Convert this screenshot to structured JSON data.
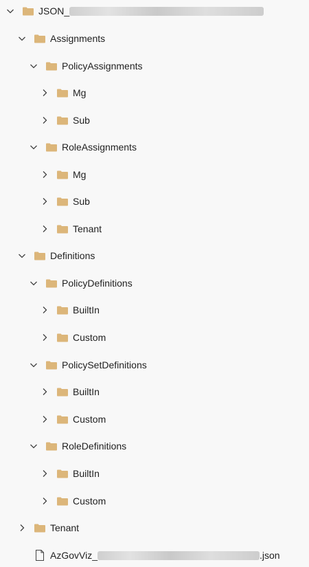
{
  "tree": {
    "root": {
      "label": "JSON_",
      "expanded": true,
      "icon": "folder-icon"
    },
    "assignments": {
      "label": "Assignments",
      "expanded": true,
      "icon": "folder-icon"
    },
    "policy_assignments": {
      "label": "PolicyAssignments",
      "expanded": true,
      "icon": "folder-icon"
    },
    "pa_mg": {
      "label": "Mg",
      "expanded": false,
      "icon": "folder-icon"
    },
    "pa_sub": {
      "label": "Sub",
      "expanded": false,
      "icon": "folder-icon"
    },
    "role_assignments": {
      "label": "RoleAssignments",
      "expanded": true,
      "icon": "folder-icon"
    },
    "ra_mg": {
      "label": "Mg",
      "expanded": false,
      "icon": "folder-icon"
    },
    "ra_sub": {
      "label": "Sub",
      "expanded": false,
      "icon": "folder-icon"
    },
    "ra_tenant": {
      "label": "Tenant",
      "expanded": false,
      "icon": "folder-icon"
    },
    "definitions": {
      "label": "Definitions",
      "expanded": true,
      "icon": "folder-icon"
    },
    "policy_definitions": {
      "label": "PolicyDefinitions",
      "expanded": true,
      "icon": "folder-icon"
    },
    "pd_builtin": {
      "label": "BuiltIn",
      "expanded": false,
      "icon": "folder-icon"
    },
    "pd_custom": {
      "label": "Custom",
      "expanded": false,
      "icon": "folder-icon"
    },
    "policyset_definitions": {
      "label": "PolicySetDefinitions",
      "expanded": true,
      "icon": "folder-icon"
    },
    "psd_builtin": {
      "label": "BuiltIn",
      "expanded": false,
      "icon": "folder-icon"
    },
    "psd_custom": {
      "label": "Custom",
      "expanded": false,
      "icon": "folder-icon"
    },
    "role_definitions": {
      "label": "RoleDefinitions",
      "expanded": true,
      "icon": "folder-icon"
    },
    "rd_builtin": {
      "label": "BuiltIn",
      "expanded": false,
      "icon": "folder-icon"
    },
    "rd_custom": {
      "label": "Custom",
      "expanded": false,
      "icon": "folder-icon"
    },
    "tenant": {
      "label": "Tenant",
      "expanded": false,
      "icon": "folder-icon"
    },
    "file": {
      "label_prefix": "AzGovViz_",
      "label_suffix": ".json",
      "icon": "file-icon"
    }
  },
  "colors": {
    "folder": "#dcb67a",
    "chevron": "#424242",
    "text": "#1f1f1f",
    "background": "#f8f8f8"
  }
}
